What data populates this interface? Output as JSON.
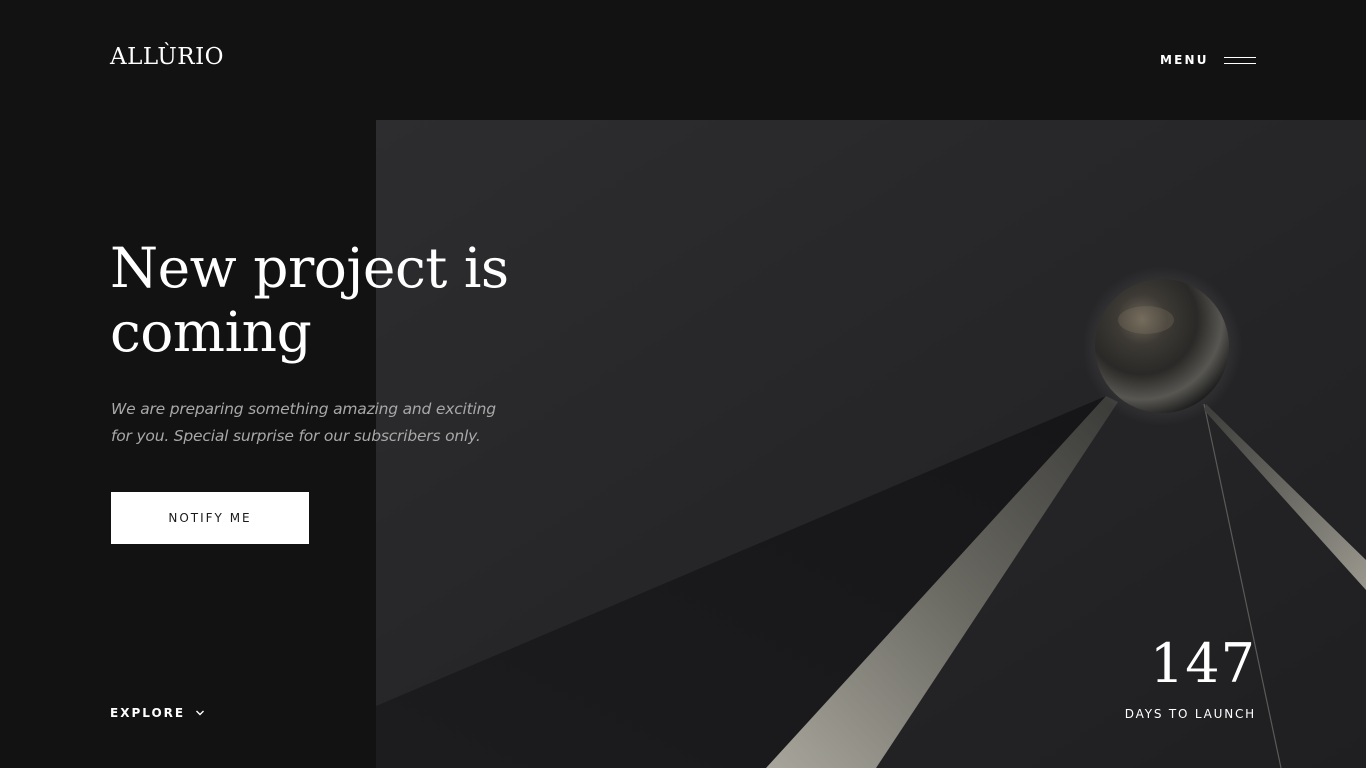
{
  "brand": {
    "logo_text": "ALLÙRIO"
  },
  "header": {
    "menu_label": "MENU",
    "menu_icon": "hamburger-icon"
  },
  "hero": {
    "title": "New project is coming",
    "subtitle": "We are preparing something amazing and exciting for you. Special surprise for our subscribers only.",
    "cta_label": "NOTIFY ME"
  },
  "footer": {
    "explore_label": "EXPLORE",
    "explore_icon": "chevron-down-icon",
    "countdown_value": "147",
    "countdown_label": "DAYS TO LAUNCH"
  },
  "colors": {
    "background": "#121212",
    "panel": "#262628",
    "text": "#ffffff",
    "muted_text": "#a8a8a8",
    "button_bg": "#ffffff",
    "button_text": "#1a1a1a"
  }
}
